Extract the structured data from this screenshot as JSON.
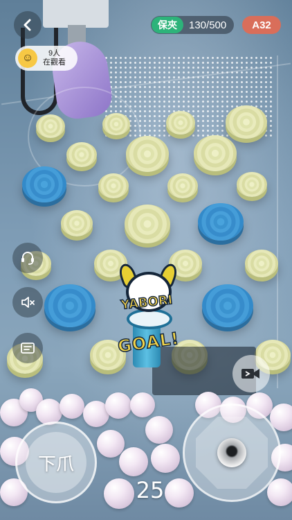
{
  "header": {
    "back_icon": "chevron-left-icon",
    "viewers": {
      "count": "9人",
      "label": "在觀看",
      "avatar_icon": "smiley-avatar-icon"
    },
    "status": {
      "badge": "保夾",
      "progress": "130/500",
      "progress_value": 130,
      "progress_max": 500
    },
    "machine_id": "A32"
  },
  "side_controls": [
    {
      "icon": "customer-service-icon"
    },
    {
      "icon": "mute-icon"
    },
    {
      "icon": "message-icon"
    }
  ],
  "camera_switch": {
    "icon": "camera-switch-icon"
  },
  "scene": {
    "logo_text": "YABORI",
    "goal_text": "GOAL!"
  },
  "controls": {
    "drop_label": "下爪",
    "timer": "25",
    "joystick_icon": "joystick-icon"
  },
  "colors": {
    "badge_green": "#2db37a",
    "machine_id_red": "#d96e5a",
    "disc_cream": "#e2e4b0",
    "disc_blue": "#3b93cf"
  }
}
